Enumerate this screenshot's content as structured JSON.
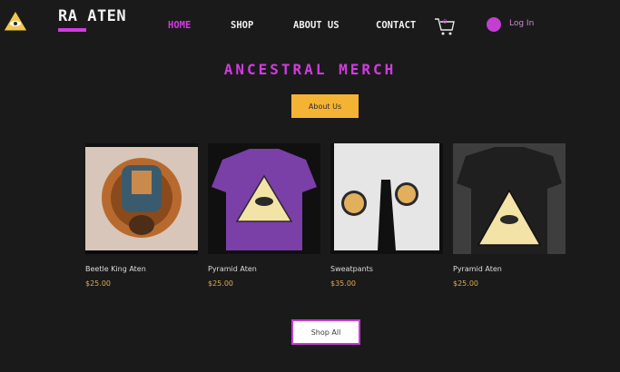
{
  "header": {
    "brand": "RA ATEN",
    "nav": [
      {
        "label": "HOME",
        "active": true
      },
      {
        "label": "SHOP",
        "active": false
      },
      {
        "label": "ABOUT US",
        "active": false
      },
      {
        "label": "CONTACT",
        "active": false
      }
    ],
    "cart_count": "0",
    "cart_icon": "shopping-cart-icon",
    "login_label": "Log In",
    "login_icon": "user-avatar-icon"
  },
  "section": {
    "title": "ANCESTRAL MERCH",
    "about_button": "About Us",
    "shop_all_button": "Shop All"
  },
  "products": [
    {
      "name": "Beetle King Aten",
      "price": "$25.00"
    },
    {
      "name": "Pyramid Aten",
      "price": "$25.00"
    },
    {
      "name": "Sweatpants",
      "price": "$35.00"
    },
    {
      "name": "Pyramid Aten",
      "price": "$25.00"
    }
  ],
  "colors": {
    "background": "#1a1a1a",
    "accent_magenta": "#d23be0",
    "button_yellow": "#f5b335",
    "price_gold": "#e0a94f",
    "shirt_purple": "#7b3fa8"
  }
}
